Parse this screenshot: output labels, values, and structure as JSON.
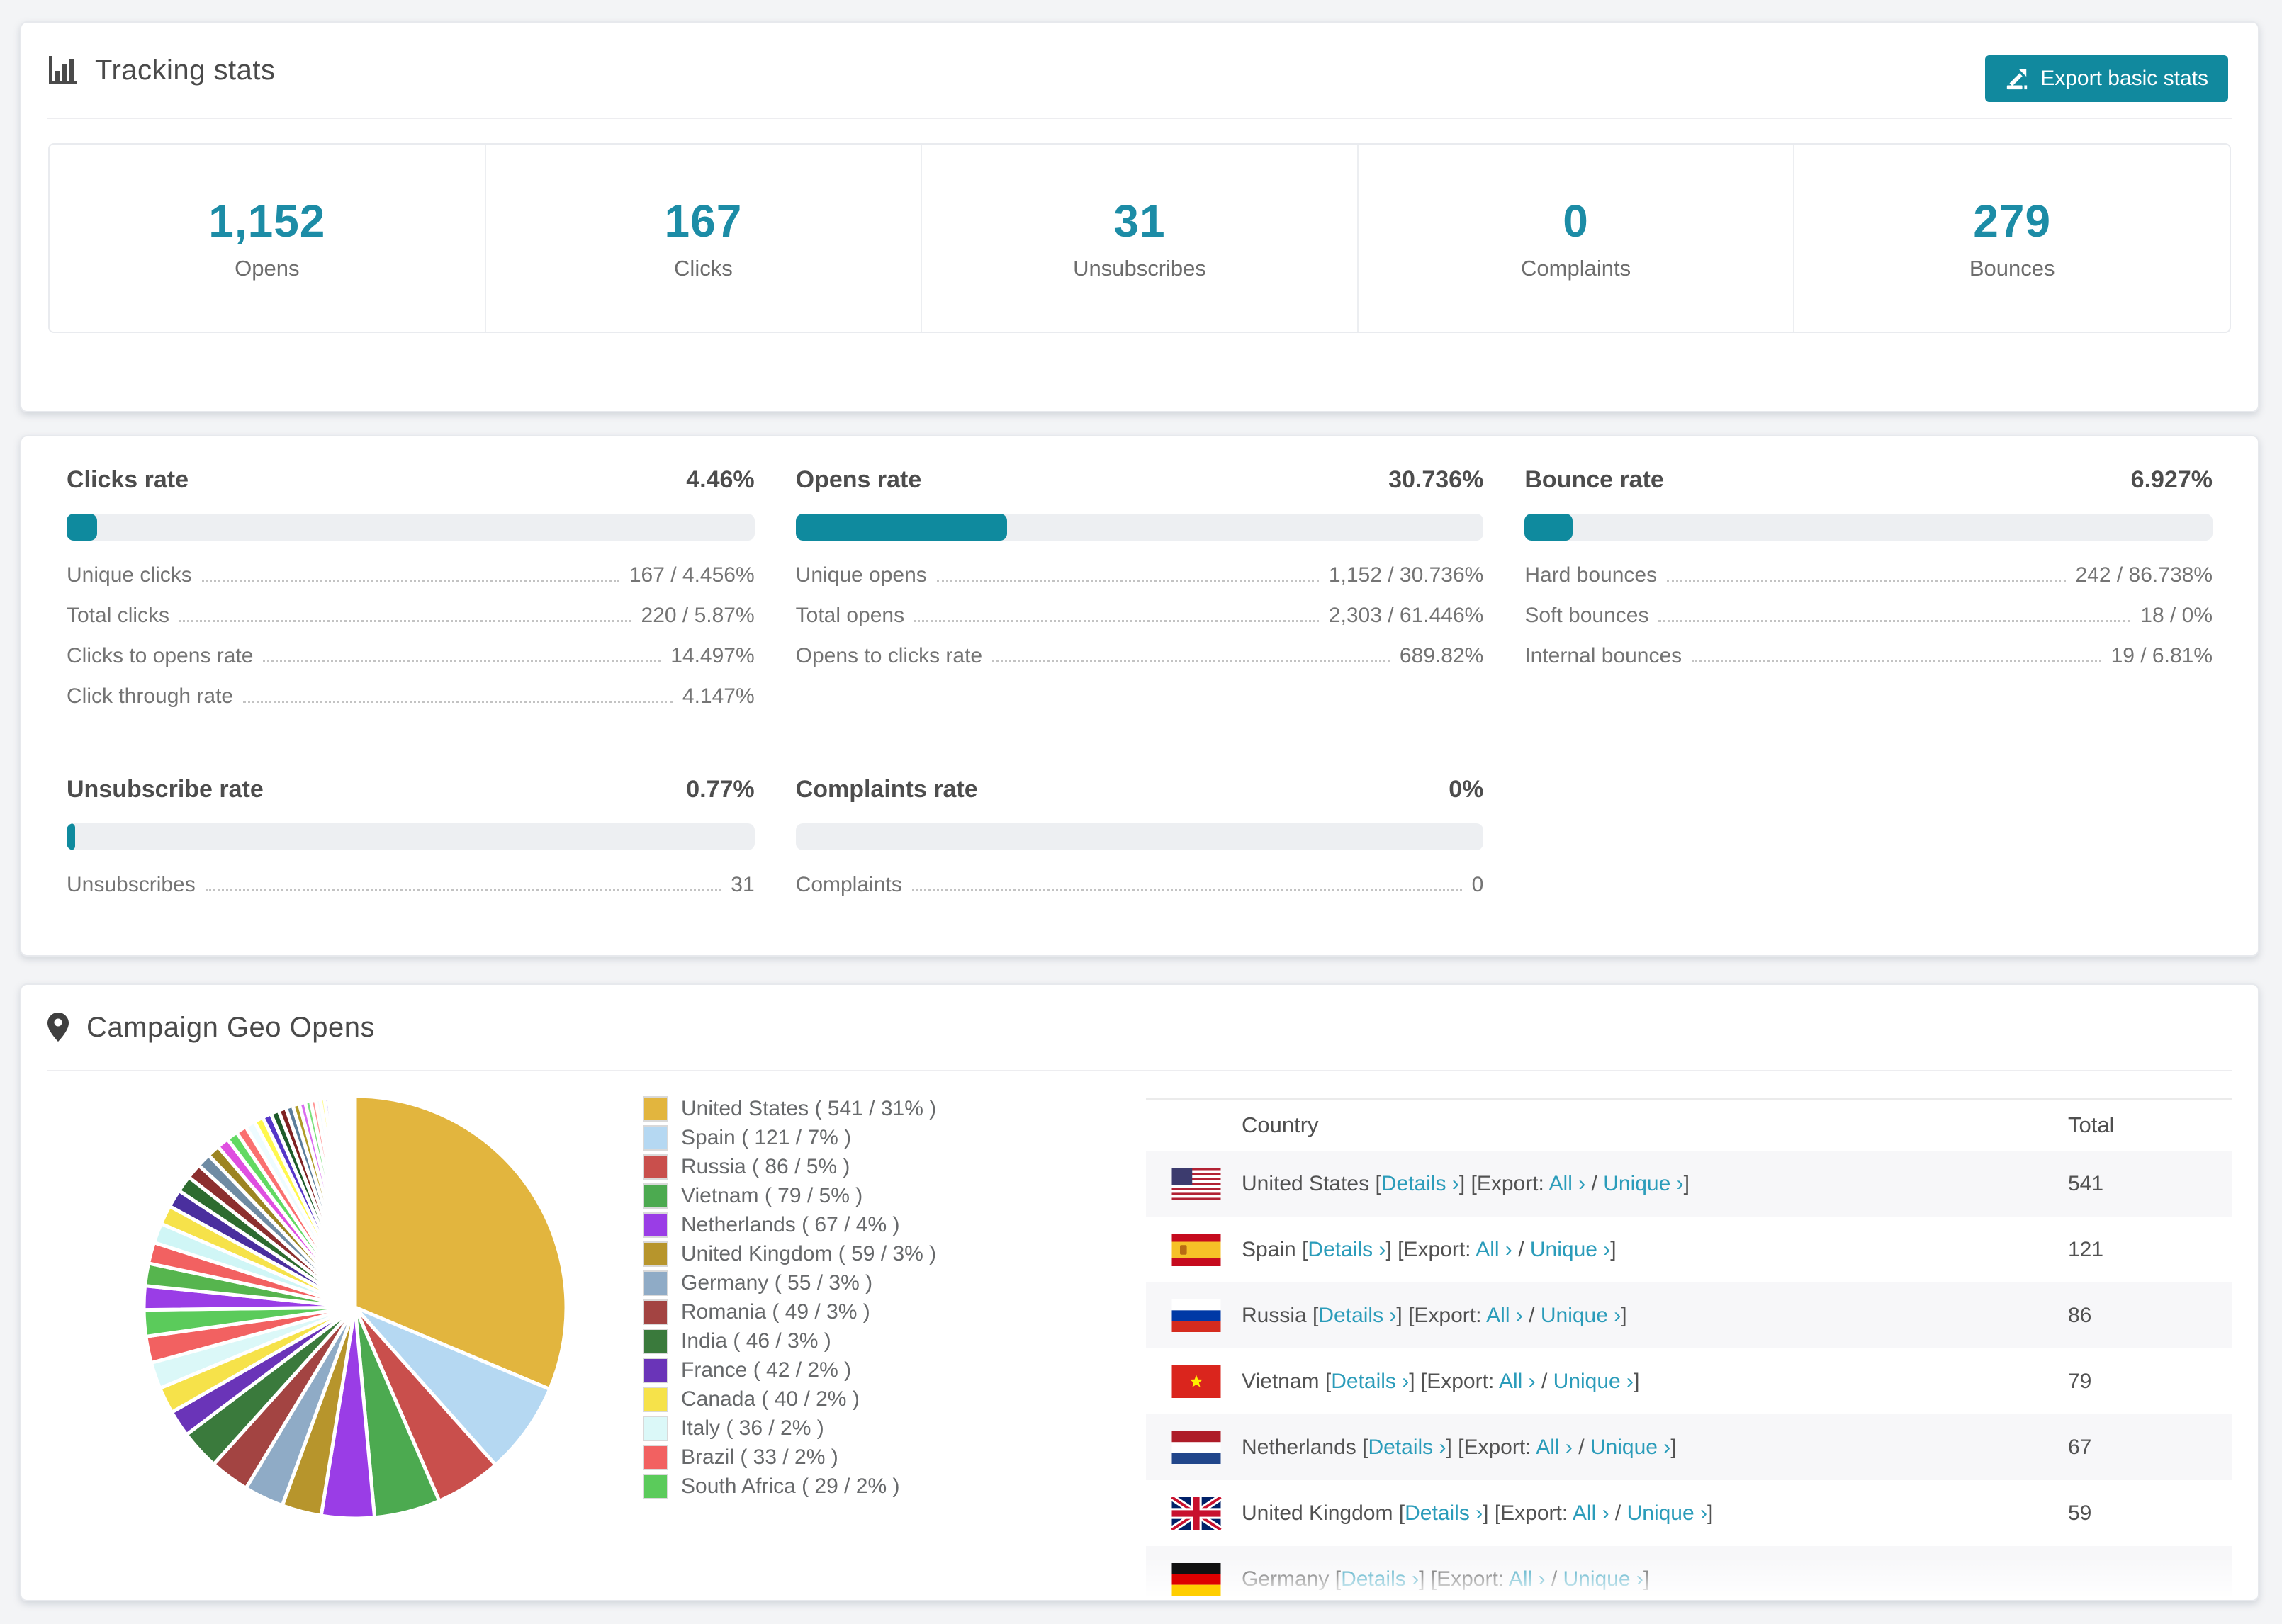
{
  "page": {
    "background": "#f3f4f6",
    "accent": "#11899e",
    "link_color": "#2b9cba"
  },
  "tracking": {
    "title": "Tracking stats",
    "export_button": "Export basic stats",
    "summary": [
      {
        "value": "1,152",
        "label": "Opens"
      },
      {
        "value": "167",
        "label": "Clicks"
      },
      {
        "value": "31",
        "label": "Unsubscribes"
      },
      {
        "value": "0",
        "label": "Complaints"
      },
      {
        "value": "279",
        "label": "Bounces"
      }
    ]
  },
  "rates": {
    "panels": [
      {
        "title": "Clicks rate",
        "value": "4.46%",
        "percent": 4.46,
        "rows": [
          {
            "label": "Unique clicks",
            "value": "167 / 4.456%"
          },
          {
            "label": "Total clicks",
            "value": "220 / 5.87%"
          },
          {
            "label": "Clicks to opens rate",
            "value": "14.497%"
          },
          {
            "label": "Click through rate",
            "value": "4.147%"
          }
        ]
      },
      {
        "title": "Opens rate",
        "value": "30.736%",
        "percent": 30.736,
        "rows": [
          {
            "label": "Unique opens",
            "value": "1,152 / 30.736%"
          },
          {
            "label": "Total opens",
            "value": "2,303 / 61.446%"
          },
          {
            "label": "Opens to clicks rate",
            "value": "689.82%"
          }
        ]
      },
      {
        "title": "Bounce rate",
        "value": "6.927%",
        "percent": 6.927,
        "rows": [
          {
            "label": "Hard bounces",
            "value": "242 / 86.738%"
          },
          {
            "label": "Soft bounces",
            "value": "18 / 0%"
          },
          {
            "label": "Internal bounces",
            "value": "19 / 6.81%"
          }
        ]
      },
      {
        "title": "Unsubscribe rate",
        "value": "0.77%",
        "percent": 0.77,
        "rows": [
          {
            "label": "Unsubscribes",
            "value": "31"
          }
        ]
      },
      {
        "title": "Complaints rate",
        "value": "0%",
        "percent": 0,
        "rows": [
          {
            "label": "Complaints",
            "value": "0"
          }
        ]
      }
    ]
  },
  "geo": {
    "title": "Campaign Geo Opens",
    "table": {
      "columns": [
        "Country",
        "Total"
      ],
      "details_label": "Details ›",
      "export_label": "Export:",
      "all_label": "All ›",
      "unique_label": "Unique ›",
      "rows": [
        {
          "country": "United States",
          "flag": "us",
          "total": "541"
        },
        {
          "country": "Spain",
          "flag": "es",
          "total": "121"
        },
        {
          "country": "Russia",
          "flag": "ru",
          "total": "86"
        },
        {
          "country": "Vietnam",
          "flag": "vn",
          "total": "79"
        },
        {
          "country": "Netherlands",
          "flag": "nl",
          "total": "67"
        },
        {
          "country": "United Kingdom",
          "flag": "gb",
          "total": "59"
        },
        {
          "country": "Germany",
          "flag": "de",
          "total": "",
          "clipped": true
        }
      ]
    }
  },
  "chart_data": {
    "type": "pie",
    "title": "Campaign Geo Opens",
    "legend_position": "right of pie",
    "legend_format": "label ( value / percent% )",
    "series": [
      {
        "label": "United States",
        "value": 541,
        "percent": 31,
        "color": "#e2b53e"
      },
      {
        "label": "Spain",
        "value": 121,
        "percent": 7,
        "color": "#b5d8f2"
      },
      {
        "label": "Russia",
        "value": 86,
        "percent": 5,
        "color": "#c94f4c"
      },
      {
        "label": "Vietnam",
        "value": 79,
        "percent": 5,
        "color": "#4caa50"
      },
      {
        "label": "Netherlands",
        "value": 67,
        "percent": 4,
        "color": "#9a3de6"
      },
      {
        "label": "United Kingdom",
        "value": 59,
        "percent": 3,
        "color": "#b7952c"
      },
      {
        "label": "Germany",
        "value": 55,
        "percent": 3,
        "color": "#8fabc6"
      },
      {
        "label": "Romania",
        "value": 49,
        "percent": 3,
        "color": "#a34442"
      },
      {
        "label": "India",
        "value": 46,
        "percent": 3,
        "color": "#3a7a3c"
      },
      {
        "label": "France",
        "value": 42,
        "percent": 2,
        "color": "#6a34b8"
      },
      {
        "label": "Canada",
        "value": 40,
        "percent": 2,
        "color": "#f6e24a"
      },
      {
        "label": "Italy",
        "value": 36,
        "percent": 2,
        "color": "#dbf8f8"
      },
      {
        "label": "Brazil",
        "value": 33,
        "percent": 2,
        "color": "#f26161"
      },
      {
        "label": "South Africa",
        "value": 29,
        "percent": 2,
        "color": "#5bcb5b"
      }
    ],
    "others_tail": {
      "note": "long tail of smaller countries, unlabeled in legend, rendered as shrinking slices",
      "values": [
        1.8,
        1.7,
        1.6,
        1.5,
        1.45,
        1.35,
        1.25,
        1.15,
        1.05,
        0.95,
        0.9,
        0.85,
        0.8,
        0.75,
        0.7,
        0.66,
        0.62,
        0.58,
        0.54,
        0.5,
        0.46,
        0.42,
        0.38,
        0.35,
        0.32,
        0.29,
        0.26,
        0.23,
        0.2,
        0.18,
        0.16,
        0.14,
        0.12,
        0.11,
        0.1,
        0.09,
        0.08,
        0.07,
        0.06,
        0.05,
        0.045,
        0.04,
        0.035,
        0.03
      ],
      "colors": [
        "#9a3de6",
        "#56b54e",
        "#f26161",
        "#d0f6f6",
        "#f6e24a",
        "#4a2f9e",
        "#2d6b2f",
        "#8c2f2f",
        "#6f8ba3",
        "#9c8422",
        "#df4fe0",
        "#62d962",
        "#fa7070",
        "#eefcff",
        "#fff84e",
        "#5636c9",
        "#1e5b2a",
        "#7f2222",
        "#5b7d9b",
        "#b09a28",
        "#d96bf0",
        "#7ce07c",
        "#ff9595",
        "#f4fdff",
        "#fffb8c",
        "#7a5cf0",
        "#3f9e4d",
        "#b85c5c",
        "#87a7c3",
        "#c9b23a",
        "#e39bf5",
        "#9fe89f",
        "#ffb3b3",
        "#f8feff",
        "#fffbc4",
        "#8f84f0",
        "#57b865",
        "#cc8080",
        "#a3c0d9",
        "#dbc95c",
        "#efc2fa",
        "#c4f5c4",
        "#ffd6d6",
        "#eafcff"
      ]
    }
  }
}
